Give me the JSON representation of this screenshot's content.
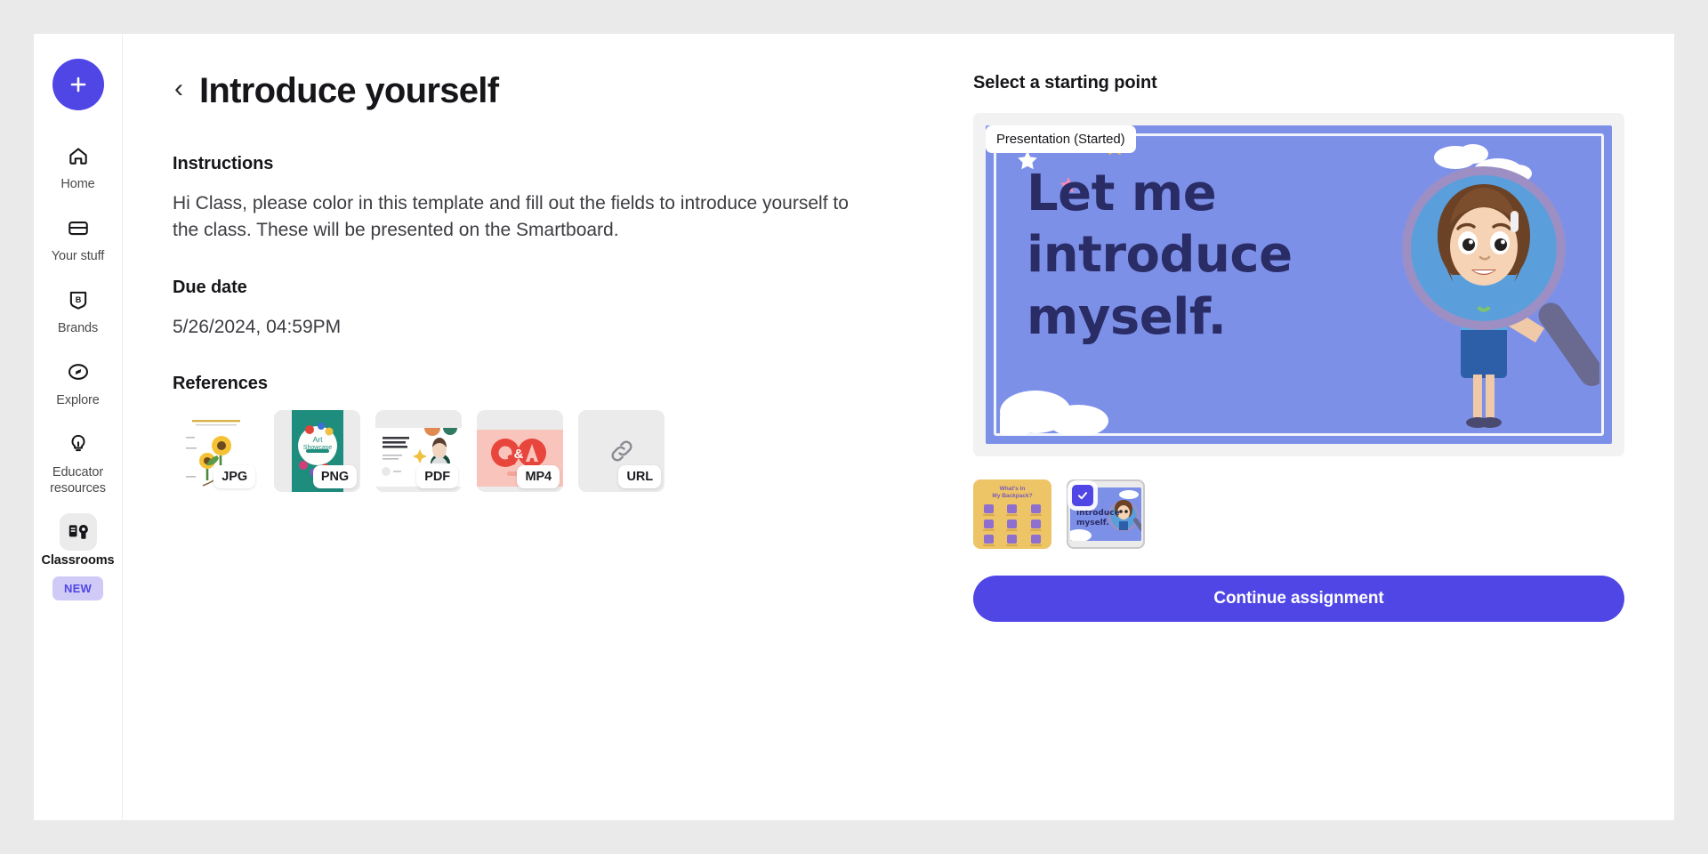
{
  "sidebar": {
    "create_button": {
      "icon": "plus-icon",
      "label": ""
    },
    "items": [
      {
        "label": "Home",
        "icon": "home-icon",
        "active": false
      },
      {
        "label": "Your stuff",
        "icon": "folder-icon",
        "active": false
      },
      {
        "label": "Brands",
        "icon": "brand-badge-icon",
        "active": false
      },
      {
        "label": "Explore",
        "icon": "compass-icon",
        "active": false
      },
      {
        "label": "Educator resources",
        "icon": "lightbulb-icon",
        "active": false
      },
      {
        "label": "Classrooms",
        "icon": "classrooms-icon",
        "active": true
      }
    ],
    "new_badge": "NEW"
  },
  "header": {
    "back_icon": "chevron-left-icon",
    "title": "Introduce yourself"
  },
  "content": {
    "instructions_heading": "Instructions",
    "instructions_body": "Hi Class, please color in this template and fill out the fields to introduce yourself to the class. These will be presented on the Smartboard.",
    "due_date_heading": "Due date",
    "due_date_value": "5/26/2024, 04:59PM",
    "references_heading": "References",
    "references": [
      {
        "tag": "JPG",
        "thumb": "sunflower-plant-diagram",
        "caption": "PARTS OF A PLANT"
      },
      {
        "tag": "PNG",
        "thumb": "art-showcase-poster",
        "caption": "Art Showcase"
      },
      {
        "tag": "PDF",
        "thumb": "copywriting-workshop-doc",
        "caption": "Copywriting Workshop For Beginners"
      },
      {
        "tag": "MP4",
        "thumb": "qa-video",
        "caption": "Q&A"
      },
      {
        "tag": "URL",
        "thumb": "link-icon",
        "caption": ""
      }
    ]
  },
  "starting_point": {
    "heading": "Select a starting point",
    "preview_badge": "Presentation (Started)",
    "slide": {
      "line1": "Let me",
      "line2": "introduce",
      "line3": "myself.",
      "background_color": "#7d90e8",
      "text_color": "#2a2c66",
      "illustration": "girl-with-magnifying-glass"
    },
    "thumbnails": [
      {
        "name": "backpack-template",
        "title_line1": "What's In",
        "title_line2": "My Backpack?",
        "selected": false,
        "background_color": "#edc466"
      },
      {
        "name": "introduce-myself-template",
        "title_line1": "introduce",
        "title_line2": "myself.",
        "selected": true,
        "background_color": "#7d90e8"
      }
    ],
    "continue_label": "Continue assignment"
  },
  "colors": {
    "accent": "#4f46e5",
    "badge_bg": "#cfcbf6",
    "panel_bg": "#f2f2f3",
    "page_bg": "#eaeaea"
  }
}
